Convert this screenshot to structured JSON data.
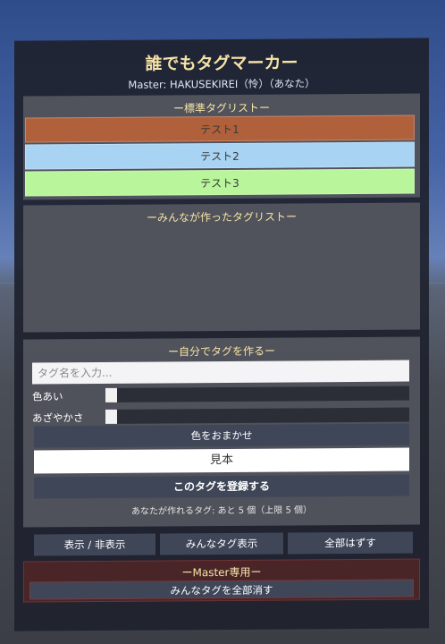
{
  "title": "誰でもタグマーカー",
  "master_line": "Master: HAKUSEKIREI（怜）（あなた）",
  "standard": {
    "heading": "ー標準タグリストー",
    "tags": [
      {
        "label": "テスト1",
        "color": "#b0603b"
      },
      {
        "label": "テスト2",
        "color": "#a9d3f2"
      },
      {
        "label": "テスト3",
        "color": "#b9f59b"
      }
    ]
  },
  "shared": {
    "heading": "ーみんなが作ったタグリストー"
  },
  "create": {
    "heading": "ー自分でタグを作るー",
    "name_placeholder": "タグ名を入力...",
    "hue_label": "色あい",
    "saturation_label": "あざやかさ",
    "hue_value": 0,
    "saturation_value": 0,
    "random_color_label": "色をおまかせ",
    "sample_label": "見本",
    "register_label": "このタグを登録する",
    "limit_text": "あなたが作れるタグ: あと 5 個（上限 5 個）"
  },
  "toolbar": {
    "toggle_label": "表示 / 非表示",
    "show_all_label": "みんなタグ表示",
    "clear_label": "全部はずす"
  },
  "master_section": {
    "heading": "ーMaster専用ー",
    "delete_all_label": "みんなタグを全部消す"
  }
}
